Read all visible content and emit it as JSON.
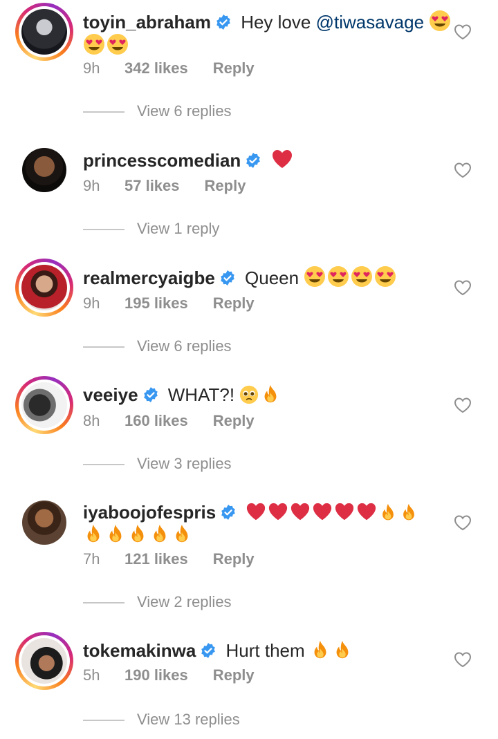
{
  "comments": [
    {
      "username": "toyin_abraham",
      "text": "Hey love",
      "mention": "@tiwasavage",
      "emojis_line1": [
        "heart-eyes"
      ],
      "emojis_line2": [
        "heart-eyes",
        "heart-eyes"
      ],
      "time": "9h",
      "likes": "342 likes",
      "reply": "Reply",
      "view_replies": "View 6 replies"
    },
    {
      "username": "princesscomedian",
      "text": "",
      "emojis_line1": [
        "red-heart"
      ],
      "time": "9h",
      "likes": "57 likes",
      "reply": "Reply",
      "view_replies": "View 1 reply"
    },
    {
      "username": "realmercyaigbe",
      "text": "Queen",
      "emojis_line1": [
        "heart-eyes",
        "heart-eyes",
        "heart-eyes",
        "heart-eyes"
      ],
      "time": "9h",
      "likes": "195 likes",
      "reply": "Reply",
      "view_replies": "View 6 replies"
    },
    {
      "username": "veeiye",
      "text": "WHAT?!",
      "emojis_line1": [
        "pleading-face",
        "fire"
      ],
      "time": "8h",
      "likes": "160 likes",
      "reply": "Reply",
      "view_replies": "View 3 replies"
    },
    {
      "username": "iyaboojofespris",
      "text": "",
      "emojis_line1": [
        "red-heart",
        "red-heart",
        "red-heart",
        "red-heart",
        "red-heart",
        "red-heart",
        "fire",
        "fire"
      ],
      "emojis_line2": [
        "fire",
        "fire",
        "fire",
        "fire",
        "fire"
      ],
      "time": "7h",
      "likes": "121 likes",
      "reply": "Reply",
      "view_replies": "View 2 replies"
    },
    {
      "username": "tokemakinwa",
      "text": "Hurt them",
      "emojis_line1": [
        "fire",
        "fire"
      ],
      "time": "5h",
      "likes": "190 likes",
      "reply": "Reply",
      "view_replies": "View 13 replies"
    }
  ],
  "colors": {
    "verified": "#3897f0",
    "mention": "#00376b",
    "muted": "#8e8e8e",
    "text": "#262626"
  }
}
